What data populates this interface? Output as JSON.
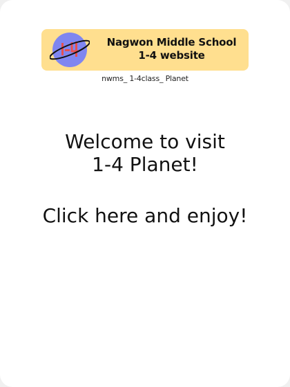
{
  "banner": {
    "line1": "Nagwon Middle School",
    "line2": "1-4 website",
    "logo_text": "1-4",
    "colors": {
      "background": "#ffdf8f",
      "logo_circle": "#7f86f0",
      "logo_glyph": "#e8504e"
    }
  },
  "handle": "nwms_ 1-4class_ Planet",
  "welcome": {
    "line1": "Welcome to visit",
    "line2": "1-4 Planet!"
  },
  "cta": "Click here and enjoy!",
  "icons": {
    "logo": "planet-icon"
  }
}
